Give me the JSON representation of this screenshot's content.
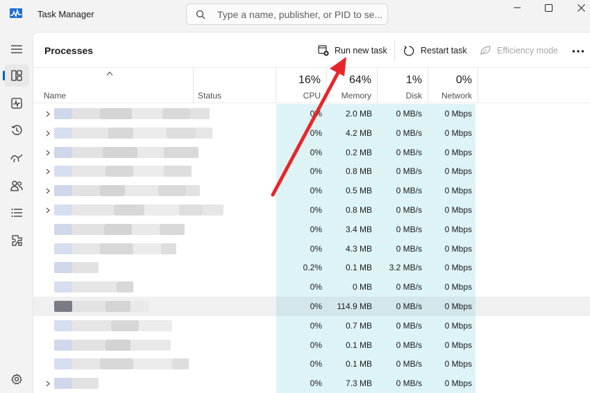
{
  "window": {
    "title": "Task Manager",
    "search_placeholder": "Type a name, publisher, or PID to se..."
  },
  "sidebar": {
    "items": [
      {
        "name": "hamburger-menu-icon",
        "active": false
      },
      {
        "name": "processes-icon",
        "active": true
      },
      {
        "name": "performance-icon",
        "active": false
      },
      {
        "name": "app-history-icon",
        "active": false
      },
      {
        "name": "startup-apps-icon",
        "active": false
      },
      {
        "name": "users-icon",
        "active": false
      },
      {
        "name": "details-icon",
        "active": false
      },
      {
        "name": "services-icon",
        "active": false
      }
    ],
    "settings": {
      "name": "settings-icon"
    }
  },
  "toolbar": {
    "page_title": "Processes",
    "run_new_task": "Run new task",
    "restart_task": "Restart task",
    "efficiency_mode": "Efficiency mode",
    "more": "..."
  },
  "table": {
    "headers": {
      "name": "Name",
      "status": "Status",
      "cpu": {
        "pct": "16%",
        "label": "CPU"
      },
      "memory": {
        "pct": "64%",
        "label": "Memory"
      },
      "disk": {
        "pct": "1%",
        "label": "Disk"
      },
      "network": {
        "pct": "0%",
        "label": "Network"
      }
    },
    "rows": [
      {
        "expandable": true,
        "cpu": "0%",
        "memory": "2.0 MB",
        "disk": "0 MB/s",
        "network": "0 Mbps"
      },
      {
        "expandable": true,
        "cpu": "0%",
        "memory": "4.2 MB",
        "disk": "0 MB/s",
        "network": "0 Mbps"
      },
      {
        "expandable": true,
        "cpu": "0%",
        "memory": "0.2 MB",
        "disk": "0 MB/s",
        "network": "0 Mbps"
      },
      {
        "expandable": true,
        "cpu": "0%",
        "memory": "0.8 MB",
        "disk": "0 MB/s",
        "network": "0 Mbps"
      },
      {
        "expandable": true,
        "cpu": "0%",
        "memory": "0.5 MB",
        "disk": "0 MB/s",
        "network": "0 Mbps"
      },
      {
        "expandable": true,
        "cpu": "0%",
        "memory": "0.8 MB",
        "disk": "0 MB/s",
        "network": "0 Mbps"
      },
      {
        "expandable": false,
        "cpu": "0%",
        "memory": "3.4 MB",
        "disk": "0 MB/s",
        "network": "0 Mbps"
      },
      {
        "expandable": false,
        "cpu": "0%",
        "memory": "4.3 MB",
        "disk": "0 MB/s",
        "network": "0 Mbps"
      },
      {
        "expandable": false,
        "cpu": "0.2%",
        "memory": "0.1 MB",
        "disk": "3.2 MB/s",
        "network": "0 Mbps"
      },
      {
        "expandable": false,
        "cpu": "0%",
        "memory": "0 MB",
        "disk": "0 MB/s",
        "network": "0 Mbps"
      },
      {
        "expandable": false,
        "cpu": "0%",
        "memory": "114.9 MB",
        "disk": "0 MB/s",
        "network": "0 Mbps",
        "selected": true
      },
      {
        "expandable": false,
        "cpu": "0%",
        "memory": "0.7 MB",
        "disk": "0 MB/s",
        "network": "0 Mbps"
      },
      {
        "expandable": false,
        "cpu": "0%",
        "memory": "0.1 MB",
        "disk": "0 MB/s",
        "network": "0 Mbps"
      },
      {
        "expandable": false,
        "cpu": "0%",
        "memory": "0.1 MB",
        "disk": "0 MB/s",
        "network": "0 Mbps"
      },
      {
        "expandable": true,
        "cpu": "0%",
        "memory": "7.3 MB",
        "disk": "0 MB/s",
        "network": "0 Mbps"
      }
    ]
  },
  "colors": {
    "accent": "#005fb8",
    "annotation_arrow": "#e8262a",
    "cpu_highlight": "#def3f6"
  }
}
